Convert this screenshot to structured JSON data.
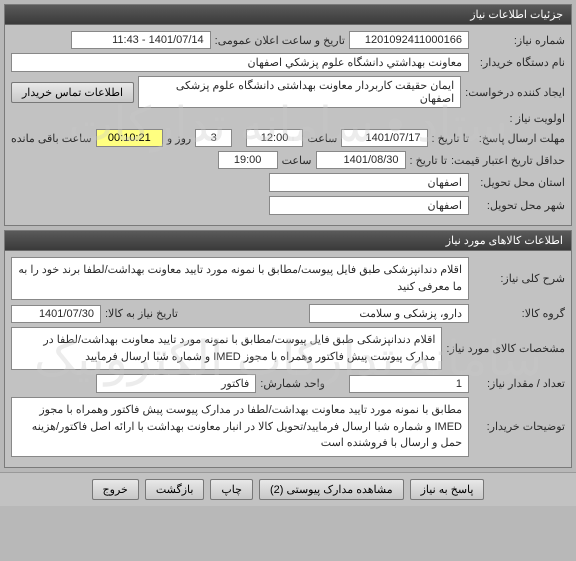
{
  "panels": {
    "need_info": {
      "title": "جزئیات اطلاعات نیاز",
      "need_number_label": "شماره نیاز:",
      "need_number": "1201092411000166",
      "announce_label": "تاریخ و ساعت اعلان عمومی:",
      "announce_value": "1401/07/14 - 11:43",
      "org_label": "نام دستگاه خریدار:",
      "org_value": "معاونت بهداشتي دانشگاه علوم پزشكي اصفهان",
      "creator_label": "ایجاد کننده درخواست:",
      "creator_value": "ايمان حقيقت كاربردار معاونت بهداشتی دانشگاه علوم پزشكی اصفهان",
      "contact_btn": "اطلاعات تماس خریدار",
      "priority_label": "اولویت نیاز :",
      "deadline_label": "مهلت ارسال پاسخ:",
      "to_date_label": "تا تاریخ :",
      "deadline_date": "1401/07/17",
      "time_label": "ساعت",
      "deadline_time": "12:00",
      "days": "3",
      "days_label": "روز و",
      "countdown": "00:10:21",
      "remaining_label": "ساعت باقی مانده",
      "validity_label": "حداقل تاریخ اعتبار قیمت:",
      "validity_to_label": "تا تاریخ :",
      "validity_date": "1401/08/30",
      "validity_time": "19:00",
      "delivery_province_label": "استان محل تحویل:",
      "delivery_province": "اصفهان",
      "delivery_city_label": "شهر محل تحویل:",
      "delivery_city": "اصفهان"
    },
    "items": {
      "title": "اطلاعات کالاهای مورد نیاز",
      "desc_label": "شرح کلی نیاز:",
      "desc_value": "اقلام دندانپزشکی طبق فایل پیوست/مطابق با نمونه مورد تایید معاونت بهداشت/لطفا برند خود را به ما معرفی کنید",
      "group_label": "گروه کالا:",
      "group_value": "دارو، پزشکی و سلامت",
      "need_date_label": "تاریخ نیاز به کالا:",
      "need_date_value": "1401/07/30",
      "spec_label": "مشخصات کالای مورد نیاز:",
      "spec_value": "اقلام دندانپزشکی طبق فایل پیوست/مطابق با نمونه مورد تایید معاونت بهداشت/لطفا در مدارک پیوست پیش فاکتور وهمراه با مجوز IMED و شماره شبا ارسال فرمایید",
      "qty_label": "تعداد / مقدار نیاز:",
      "qty_value": "1",
      "unit_label": "واحد شمارش:",
      "unit_value": "فاكتور",
      "buyer_notes_label": "توضیحات خریدار:",
      "buyer_notes_value": "مطابق با نمونه مورد تایید معاونت بهداشت/لطفا در مدارک پیوست پیش فاکتور وهمراه با مجوز IMED و شماره شبا ارسال فرمایید/تحویل کالا در انبار معاونت بهداشت با ارائه اصل فاکتور/هزینه حمل و ارسال با فروشنده است"
    }
  },
  "buttons": {
    "reply": "پاسخ به نیاز",
    "attachments": "مشاهده مدارک پیوستی (2)",
    "print": "چاپ",
    "back": "بازگشت",
    "exit": "خروج"
  }
}
